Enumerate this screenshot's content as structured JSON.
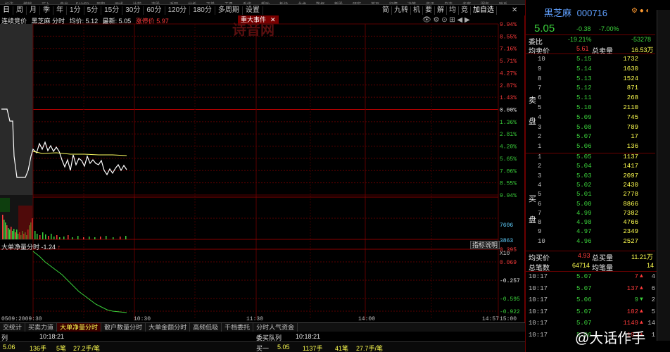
{
  "top_toolbar": [
    "标注",
    "撤销",
    "买入",
    "卖出",
    "F10/F9",
    "周期",
    "画线",
    "比较",
    "选股",
    "返回",
    "分析",
    "下单",
    "工具",
    "系统",
    "帮助",
    "板块",
    "龙虎",
    "数据",
    "新股",
    "研究",
    "首页",
    "行情",
    "决策",
    "资讯",
    "自选",
    "多窗",
    "服务",
    "联系"
  ],
  "periods": [
    "日",
    "周",
    "月",
    "季",
    "年",
    "1分",
    "5分",
    "15分",
    "30分",
    "60分",
    "120分",
    "180分",
    "多周期",
    "设置"
  ],
  "active_period": "日",
  "right_tabs": [
    "简",
    "九转",
    "机",
    "要",
    "解",
    "均",
    "竞",
    "加自选"
  ],
  "info_line": {
    "auction": "连续竞价",
    "stock": "黑芝麻 分时",
    "avg": "均价: 5.12",
    "latest": "最新: 5.05",
    "limit_label": "涨停价",
    "limit_value": "5.97"
  },
  "event_tab": "重大事件",
  "watermark": "诗音网",
  "price_axis": {
    "left": [
      "",
      "",
      "",
      "",
      "",
      "",
      "",
      "",
      "",
      "",
      ""
    ],
    "right": [
      "9.94%",
      "8.55%",
      "7.16%",
      "5.71%",
      "4.27%",
      "2.87%",
      "1.43%",
      "0.00%",
      "1.36%",
      "2.81%",
      "4.20%",
      "5.65%",
      "7.06%",
      "8.55%",
      "9.94%"
    ]
  },
  "volume_axis": [
    "7606",
    "3863",
    "X10"
  ],
  "indicator": {
    "name": "大单净量分时",
    "value": "-1.24",
    "arrow": "↑",
    "help": "指标说明",
    "axis": [
      "0.395",
      "0.069",
      "-0.257",
      "-0.595",
      "-0.922"
    ]
  },
  "time_axis": [
    "0509:2009:30",
    "10:30",
    "11:30",
    "14:00",
    "14:57",
    "15:00"
  ],
  "bottom_tabs": [
    "交统计",
    "买卖力道",
    "大单净量分时",
    "散户数量分时",
    "大单金额分时",
    "高频低吸",
    "千档委托",
    "分时人气资金"
  ],
  "active_bottom_tab": "大单净量分时",
  "order_queue": {
    "label": "委买队列",
    "time": "10:18:21"
  },
  "left_queue": {
    "label": "列",
    "time": "10:18:21"
  },
  "status_left": {
    "price": "5.06",
    "vol": "136手",
    "count": "5笔",
    "amount": "27.2手/笔"
  },
  "status_mid": {
    "label": "买一",
    "price": "5.05",
    "vol": "1137手",
    "count": "41笔",
    "amount": "27.7手/笔"
  },
  "quote": {
    "name": "黑芝麻",
    "code": "000716",
    "price": "5.05",
    "change": "-0.38",
    "pct": "-7.00%",
    "ratio_label": "委比",
    "ratio": "-19.21%",
    "diff": "-53278",
    "avg_sell_label": "均卖价",
    "avg_sell": "5.61",
    "total_sell_label": "总卖量",
    "total_sell": "16.53万",
    "avg_buy_label": "均买价",
    "avg_buy": "4.93",
    "total_buy_label": "总买量",
    "total_buy": "11.21万",
    "total_count_label": "总笔数",
    "total_count": "64714",
    "avg_count_label": "均笔量",
    "avg_count": "14"
  },
  "sell_label": [
    "卖",
    "盘"
  ],
  "buy_label": [
    "买",
    "盘"
  ],
  "sell_book": [
    {
      "lv": "10",
      "price": "5.15",
      "vol": "1732"
    },
    {
      "lv": "9",
      "price": "5.14",
      "vol": "1630"
    },
    {
      "lv": "8",
      "price": "5.13",
      "vol": "1524"
    },
    {
      "lv": "7",
      "price": "5.12",
      "vol": "871"
    },
    {
      "lv": "6",
      "price": "5.11",
      "vol": "268"
    },
    {
      "lv": "5",
      "price": "5.10",
      "vol": "2110"
    },
    {
      "lv": "4",
      "price": "5.09",
      "vol": "745"
    },
    {
      "lv": "3",
      "price": "5.08",
      "vol": "789"
    },
    {
      "lv": "2",
      "price": "5.07",
      "vol": "17"
    },
    {
      "lv": "1",
      "price": "5.06",
      "vol": "136"
    }
  ],
  "buy_book": [
    {
      "lv": "1",
      "price": "5.05",
      "vol": "1137"
    },
    {
      "lv": "2",
      "price": "5.04",
      "vol": "1417"
    },
    {
      "lv": "3",
      "price": "5.03",
      "vol": "2097"
    },
    {
      "lv": "4",
      "price": "5.02",
      "vol": "2430"
    },
    {
      "lv": "5",
      "price": "5.01",
      "vol": "2778"
    },
    {
      "lv": "6",
      "price": "5.00",
      "vol": "8866"
    },
    {
      "lv": "7",
      "price": "4.99",
      "vol": "7382"
    },
    {
      "lv": "8",
      "price": "4.98",
      "vol": "4766"
    },
    {
      "lv": "9",
      "price": "4.97",
      "vol": "2349"
    },
    {
      "lv": "10",
      "price": "4.96",
      "vol": "2527"
    }
  ],
  "ticks": [
    {
      "t": "10:17",
      "p": "5.07",
      "v": "7",
      "dir": "up",
      "n": "4"
    },
    {
      "t": "10:17",
      "p": "5.07",
      "v": "137",
      "dir": "up",
      "n": "6"
    },
    {
      "t": "10:17",
      "p": "5.06",
      "v": "9",
      "dir": "down",
      "n": "2"
    },
    {
      "t": "10:17",
      "p": "5.07",
      "v": "102",
      "dir": "up",
      "n": "5"
    },
    {
      "t": "10:17",
      "p": "5.07",
      "v": "1149",
      "dir": "up",
      "n": "14"
    },
    {
      "t": "10:17",
      "p": "5.06",
      "v": "193",
      "dir": "up",
      "n": "1"
    }
  ],
  "overlay_watermark": "@大话作手",
  "colors": {
    "up": "#ff3b3b",
    "down": "#3bd13b",
    "grid": "#6a0000",
    "bg": "#000000",
    "vol": "#ffff50"
  }
}
